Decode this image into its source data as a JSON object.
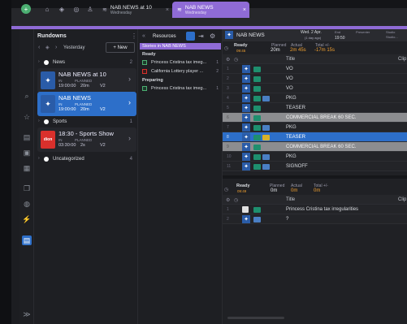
{
  "topbar": {
    "tab1_title": "NAB NEWS at 10",
    "tab1_sub": "Wednesday",
    "tab2_title": "NAB NEWS",
    "tab2_sub": "Wednesday"
  },
  "rundowns": {
    "title": "Rundowns",
    "nav_label": "Yesterday",
    "new_label": "+ New",
    "groups": [
      {
        "name": "News",
        "count": "2"
      },
      {
        "name": "Sports",
        "count": "1"
      },
      {
        "name": "Uncategorized",
        "count": "4"
      }
    ],
    "items": [
      {
        "title": "NAB NEWS at 10",
        "in_label": "IN",
        "planned_label": "PLANNED",
        "in": "19:00:00",
        "planned": "20m",
        "version": "V2"
      },
      {
        "title": "NAB NEWS",
        "in_label": "IN",
        "planned_label": "PLANNED",
        "in": "19:00:00",
        "planned": "20m",
        "version": "V2"
      },
      {
        "title": "18:30 - Sports Show",
        "in_label": "IN",
        "planned_label": "PLANNED",
        "in": "03:30:00",
        "planned": "2s",
        "version": "V2",
        "thumb": "dion"
      }
    ]
  },
  "resources": {
    "title": "Resources",
    "section": "Stories in NAB NEWS",
    "ready_label": "Ready",
    "ready": [
      {
        "text": "Princess Cristina tax imeg...",
        "count": "1"
      },
      {
        "text": "California Lottery player ...",
        "count": "2"
      }
    ],
    "preparing_label": "Preparing",
    "preparing": [
      {
        "text": "Princess Cristina tax imeg...",
        "count": "1"
      }
    ]
  },
  "main": {
    "tab_title": "NAB NEWS",
    "date": "Wed. 2 Apr.",
    "date_sub": "(1 day ago)",
    "end_label": "End",
    "end_val": "19:50",
    "presenter_label": "Presenter",
    "studio_label": "Studio",
    "studio_val": "Studio...",
    "status": "Ready",
    "status_time": "09:45",
    "planned_label": "Planned",
    "planned": "20m",
    "actual_label": "Actual",
    "actual": "2m 45s",
    "total_label": "Total +/-",
    "total": "-17m 15s",
    "col_title": "Title",
    "col_clip": "Clip",
    "rows": [
      {
        "num": "1",
        "title": "VO"
      },
      {
        "num": "2",
        "title": "VO"
      },
      {
        "num": "3",
        "title": "VO"
      },
      {
        "num": "4",
        "title": "PKG"
      },
      {
        "num": "5",
        "title": "TEASER"
      },
      {
        "num": "6",
        "title": "COMMERCIAL BREAK 60 SEC."
      },
      {
        "num": "7",
        "title": "PKG"
      },
      {
        "num": "8",
        "title": "TEASER"
      },
      {
        "num": "9",
        "title": "COMMERCIAL BREAK 60 SEC."
      },
      {
        "num": "10",
        "title": "PKG"
      },
      {
        "num": "11",
        "title": "SIGNOFF"
      }
    ],
    "bottom": {
      "status": "Ready",
      "status_time": "09:49",
      "planned_label": "Planned",
      "planned": "0m",
      "actual_label": "Actual",
      "actual": "0m",
      "total_label": "Total +/-",
      "total": "0m",
      "col_title": "Title",
      "col_clip": "Clip",
      "rows": [
        {
          "num": "1",
          "title": "Princess Cristina tax irregularities"
        },
        {
          "num": "2",
          "title": "?"
        }
      ]
    }
  }
}
